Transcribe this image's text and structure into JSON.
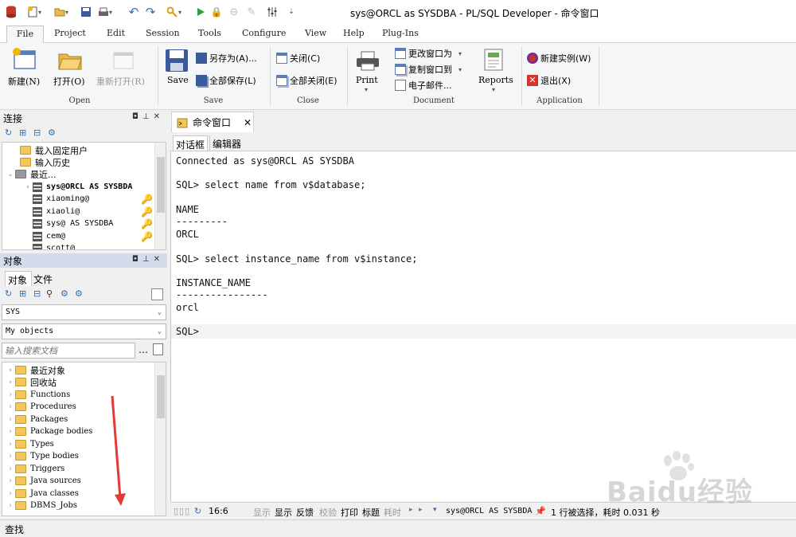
{
  "window": {
    "title": "sys@ORCL as SYSDBA - PL/SQL Developer - 命令窗口"
  },
  "menu": [
    "File",
    "Project",
    "Edit",
    "Session",
    "Tools",
    "Configure",
    "View",
    "Help",
    "Plug-Ins"
  ],
  "ribbon": {
    "open_group": {
      "label": "Open",
      "new": "新建(N)",
      "open": "打开(O)",
      "reopen": "重新打开(R)"
    },
    "save_group": {
      "label": "Save",
      "save": "Save",
      "save_as": "另存为(A)...",
      "save_all": "全部保存(L)"
    },
    "close_group": {
      "label": "Close",
      "close": "关闭(C)",
      "close_all": "全部关闭(E)"
    },
    "document_group": {
      "label": "Document",
      "print": "Print",
      "change_window": "更改窗口为",
      "copy_window": "复制窗口到",
      "email": "电子邮件...",
      "reports": "Reports"
    },
    "application_group": {
      "label": "Application",
      "new_instance": "新建实例(W)",
      "exit": "退出(X)"
    }
  },
  "connections_panel": {
    "title": "连接",
    "items": [
      "载入固定用户",
      "输入历史",
      "最近...",
      "sys@ORCL AS SYSBDA",
      "xiaoming@",
      "xiaoli@",
      "sys@ AS SYSDBA",
      "cem@",
      "scott@"
    ]
  },
  "objects_panel": {
    "title": "对象",
    "tabs": [
      "对象",
      "文件"
    ],
    "user_select": "SYS",
    "filter_select": "My objects",
    "search_placeholder": "输入搜索文档",
    "items": [
      "最近对象",
      "回收站",
      "Functions",
      "Procedures",
      "Packages",
      "Package bodies",
      "Types",
      "Type bodies",
      "Triggers",
      "Java sources",
      "Java classes",
      "DBMS_Jobs"
    ]
  },
  "document_tab": {
    "label": "命令窗口"
  },
  "subtabs": [
    "对话框",
    "编辑器"
  ],
  "console_lines": [
    "Connected as sys@ORCL AS SYSDBA",
    "",
    "SQL> select name from v$database;",
    "",
    "NAME",
    "---------",
    "ORCL",
    "",
    "SQL> select instance_name from v$instance;",
    "",
    "INSTANCE_NAME",
    "----------------",
    "orcl",
    "",
    "SQL> "
  ],
  "status": {
    "position": "16:6",
    "buttons": [
      "显示",
      "显示",
      "反馈",
      "校验",
      "打印",
      "标题",
      "耗时"
    ],
    "connection": "sys@ORCL AS SYSBDA",
    "message": "1 行被选择，耗时 0.031 秒"
  },
  "find_bar": {
    "label": "查找"
  },
  "watermark": {
    "text": "Baidu经验"
  },
  "colors": {
    "accent": "#2f6fb5",
    "panel_header": "#d3dcea",
    "annotation_arrow": "#e53935"
  }
}
